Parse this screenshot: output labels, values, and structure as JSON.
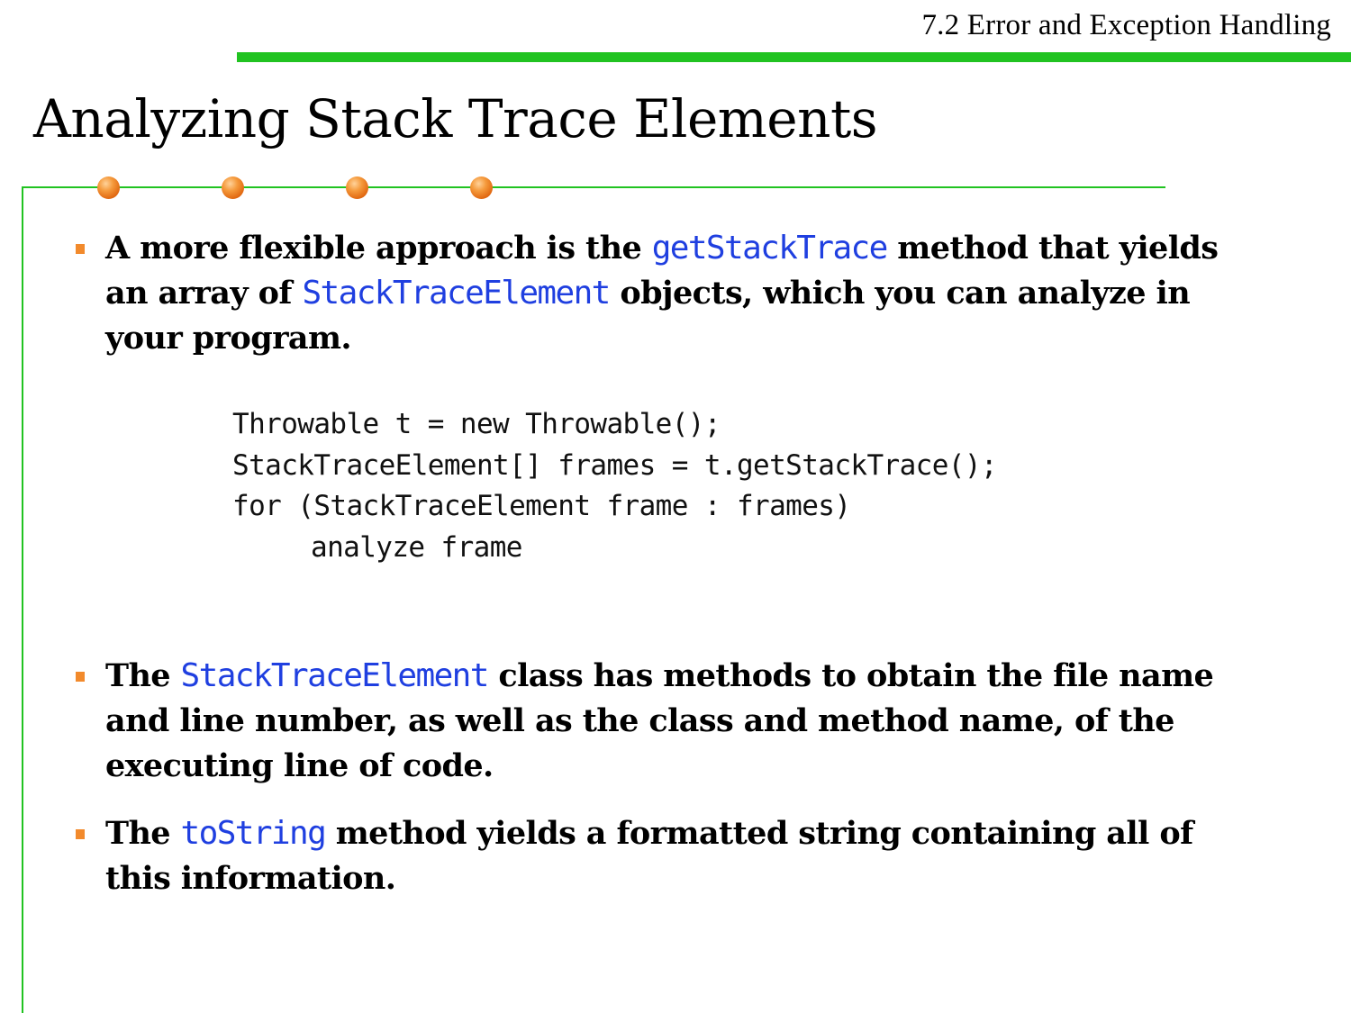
{
  "header": {
    "section_title": "7.2 Error and Exception Handling",
    "rule_color": "#21c321"
  },
  "slide": {
    "title": "Analyzing Stack Trace Elements",
    "dot_color": "#f28a2c",
    "code_color": "#1f3fe0"
  },
  "bullets": [
    {
      "parts": [
        {
          "text": "A more flexible approach is the ",
          "code": false
        },
        {
          "text": "getStackTrace",
          "code": true
        },
        {
          "text": " method that yields an array of ",
          "code": false
        },
        {
          "text": "StackTraceElement",
          "code": true
        },
        {
          "text": " objects, which you can analyze in your program.",
          "code": false
        }
      ]
    },
    {
      "parts": [
        {
          "text": "The ",
          "code": false
        },
        {
          "text": "StackTraceElement",
          "code": true
        },
        {
          "text": " class has methods to obtain the file name and line number, as well as the class and method name, of the executing line of code.",
          "code": false
        }
      ]
    },
    {
      "parts": [
        {
          "text": "The ",
          "code": false
        },
        {
          "text": "toString",
          "code": true
        },
        {
          "text": " method yields a formatted string containing all of this information.",
          "code": false
        }
      ]
    }
  ],
  "code_block": {
    "lines": [
      "Throwable t = new Throwable();",
      "StackTraceElement[] frames = t.getStackTrace();",
      "for (StackTraceElement frame : frames)",
      "analyze frame"
    ]
  }
}
